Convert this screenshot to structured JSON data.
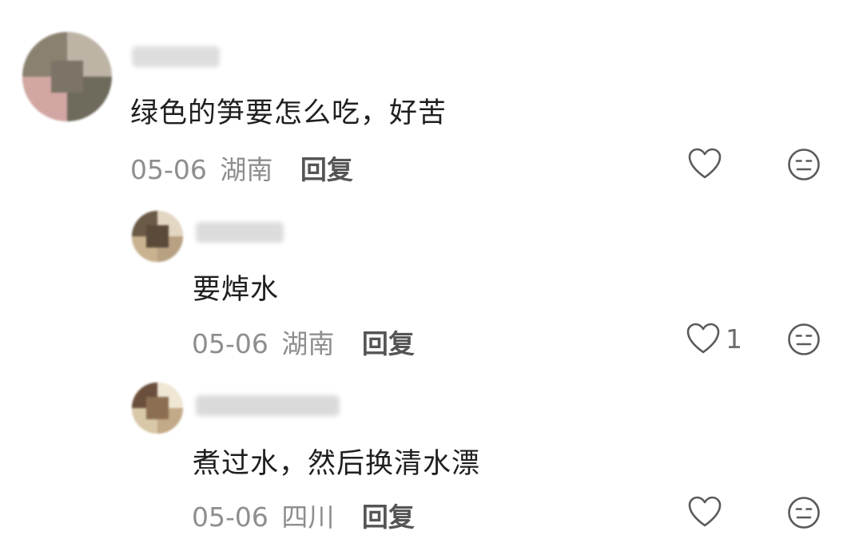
{
  "comments": [
    {
      "content": "绿色的笋要怎么吃，好苦",
      "date": "05-06",
      "location": "湖南",
      "reply_label": "回复",
      "like_count": "",
      "avatar_colors": [
        "#8a8170",
        "#a29a8c",
        "#6e6a5c",
        "#bdb4a6",
        "#d2a6a2",
        "#7c7466"
      ]
    },
    {
      "content": "要焯水",
      "date": "05-06",
      "location": "湖南",
      "reply_label": "回复",
      "like_count": "1",
      "avatar_colors": [
        "#6b5a45",
        "#c9b28f",
        "#a18565",
        "#e3d6c2",
        "#5a4a3a",
        "#b8a082"
      ]
    },
    {
      "content": "煮过水，然后换清水漂",
      "date": "05-06",
      "location": "四川",
      "reply_label": "回复",
      "like_count": "",
      "avatar_colors": [
        "#6a4f3c",
        "#d8c8a8",
        "#a88a6a",
        "#efe6d4",
        "#8c6e52",
        "#c2a987"
      ]
    }
  ],
  "icons": {
    "like": "heart-outline-icon",
    "dislike": "neutral-face-icon"
  },
  "colors": {
    "text": "#1f1f1f",
    "meta": "#8e8e8e",
    "reply": "#555555",
    "icon": "#5a5a5a",
    "username_blur": "#d6d6d6"
  }
}
